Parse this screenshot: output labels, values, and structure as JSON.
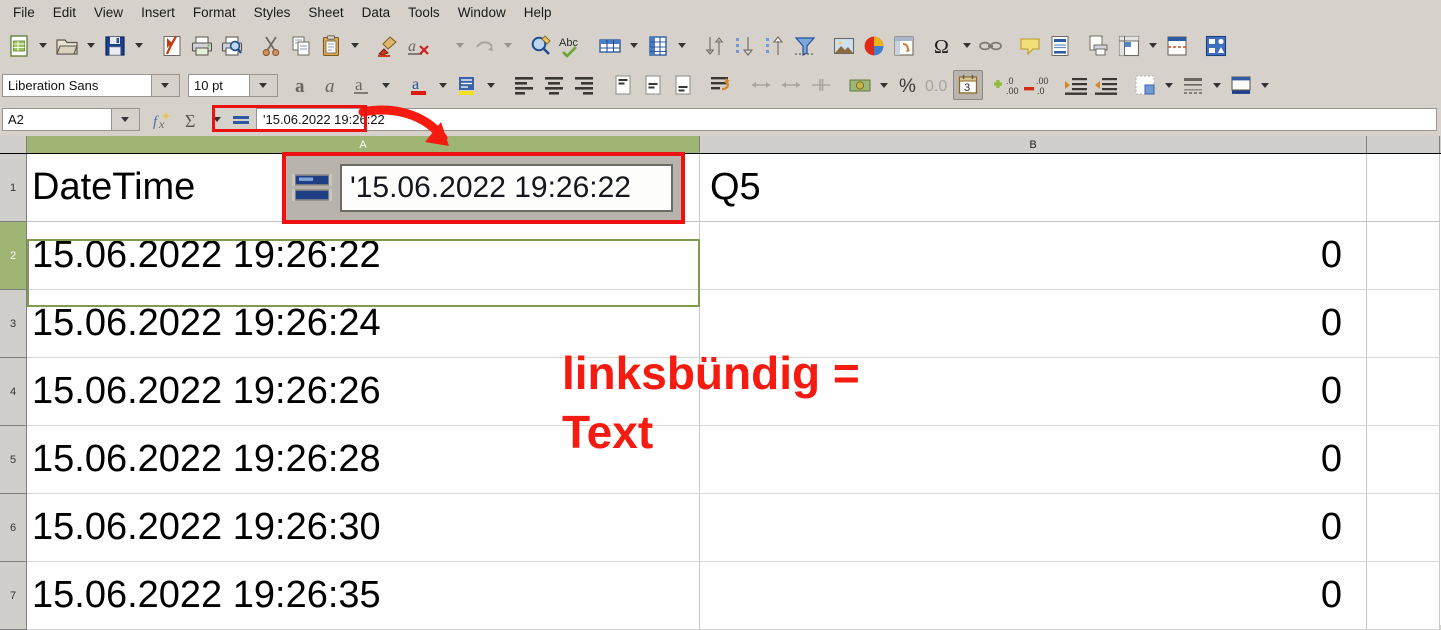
{
  "app": {
    "name": "LibreOffice Calc"
  },
  "menubar": {
    "items": [
      {
        "label": "File",
        "name": "menu-file"
      },
      {
        "label": "Edit",
        "name": "menu-edit"
      },
      {
        "label": "View",
        "name": "menu-view"
      },
      {
        "label": "Insert",
        "name": "menu-insert"
      },
      {
        "label": "Format",
        "name": "menu-format"
      },
      {
        "label": "Styles",
        "name": "menu-styles"
      },
      {
        "label": "Sheet",
        "name": "menu-sheet"
      },
      {
        "label": "Data",
        "name": "menu-data"
      },
      {
        "label": "Tools",
        "name": "menu-tools"
      },
      {
        "label": "Window",
        "name": "menu-window"
      },
      {
        "label": "Help",
        "name": "menu-help"
      }
    ]
  },
  "standard_toolbar": {
    "icons": [
      "new-document-icon",
      "open-file-icon",
      "save-icon",
      "export-pdf-icon",
      "print-icon",
      "print-preview-icon",
      "cut-icon",
      "copy-icon",
      "paste-icon",
      "clone-formatting-icon",
      "clear-formatting-icon",
      "undo-icon",
      "redo-icon",
      "find-replace-icon",
      "spelling-icon",
      "row-icon",
      "column-icon",
      "sort-ascending-descending-icon",
      "sort-ascending-icon",
      "sort-descending-icon",
      "autofilter-icon",
      "insert-image-icon",
      "insert-chart-icon",
      "pivot-table-icon",
      "special-character-icon",
      "insert-hyperlink-icon",
      "comment-icon",
      "headers-footers-icon",
      "freeze-rows-columns-icon",
      "split-window-icon",
      "show-draw-functions-icon"
    ]
  },
  "formatting_toolbar": {
    "font_name": "Liberation Sans",
    "font_size": "10 pt",
    "icons": [
      "bold-icon",
      "italic-icon",
      "underline-icon",
      "font-color-icon",
      "highlight-color-icon",
      "background-color-icon",
      "align-left-icon",
      "align-center-icon",
      "align-right-icon",
      "align-top-icon",
      "align-center-vertically-icon",
      "align-bottom-icon",
      "wrap-text-icon",
      "merge-cells-icon",
      "merge-center-icon",
      "unmerge-icon",
      "currency-icon",
      "percent-icon",
      "number-format-icon",
      "date-format-icon",
      "add-decimal-icon",
      "delete-decimal-icon",
      "increase-indent-icon",
      "decrease-indent-icon",
      "borders-icon",
      "border-style-icon",
      "background-cell-color-icon"
    ],
    "active_format": "date-format-icon"
  },
  "formula_bar": {
    "name_box_value": "A2",
    "formula_value": "'15.06.2022 19:26:22",
    "icons": [
      "function-wizard-icon",
      "sum-icon",
      "formula-icon"
    ]
  },
  "sheet": {
    "columns": [
      {
        "label": "A",
        "selected": true
      },
      {
        "label": "B",
        "selected": false
      },
      {
        "label": "",
        "selected": false
      }
    ],
    "rows": [
      {
        "header": "1",
        "selected": false,
        "a": "DateTime",
        "b": "Q5",
        "c": ""
      },
      {
        "header": "2",
        "selected": true,
        "a": "15.06.2022 19:26:22",
        "b": "0",
        "c": ""
      },
      {
        "header": "3",
        "selected": false,
        "a": "15.06.2022 19:26:24",
        "b": "0",
        "c": ""
      },
      {
        "header": "4",
        "selected": false,
        "a": "15.06.2022 19:26:26",
        "b": "0",
        "c": ""
      },
      {
        "header": "5",
        "selected": false,
        "a": "15.06.2022 19:26:28",
        "b": "0",
        "c": ""
      },
      {
        "header": "6",
        "selected": false,
        "a": "15.06.2022 19:26:30",
        "b": "0",
        "c": ""
      },
      {
        "header": "7",
        "selected": false,
        "a": "15.06.2022 19:26:35",
        "b": "0",
        "c": ""
      }
    ],
    "active_cell": "A2"
  },
  "annotations": {
    "note_text": "linksbündig =\nText",
    "magnified_formula_value": "'15.06.2022 19:26:22",
    "accent_color": "#ee1111",
    "note_color": "#f51b10",
    "selection_color": "#9fb573"
  }
}
